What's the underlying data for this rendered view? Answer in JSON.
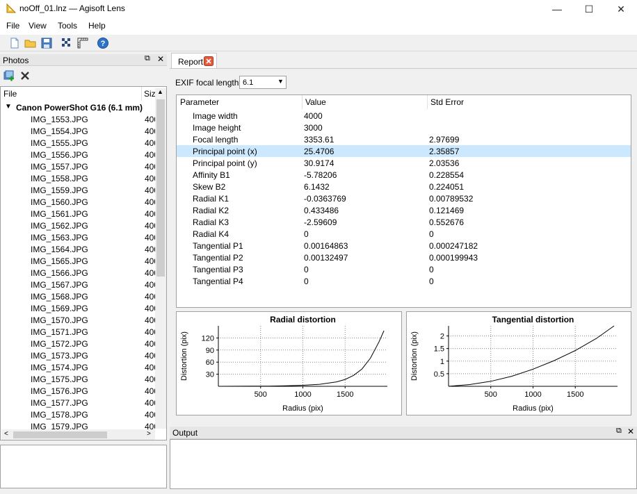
{
  "window": {
    "title": "noOff_01.lnz — Agisoft Lens",
    "minimize": "—",
    "maximize": "☐",
    "close": "✕"
  },
  "menu": [
    "File",
    "View",
    "Tools",
    "Help"
  ],
  "toolbar_icons": [
    "new-file-icon",
    "open-folder-icon",
    "save-icon",
    "calibration-pattern-icon",
    "ruler-icon",
    "help-icon"
  ],
  "photos": {
    "title": "Photos",
    "columns": [
      "File",
      "Siz"
    ],
    "group": "Canon PowerShot G16 (6.1 mm)",
    "size_prefix": "400",
    "files": [
      "IMG_1553.JPG",
      "IMG_1554.JPG",
      "IMG_1555.JPG",
      "IMG_1556.JPG",
      "IMG_1557.JPG",
      "IMG_1558.JPG",
      "IMG_1559.JPG",
      "IMG_1560.JPG",
      "IMG_1561.JPG",
      "IMG_1562.JPG",
      "IMG_1563.JPG",
      "IMG_1564.JPG",
      "IMG_1565.JPG",
      "IMG_1566.JPG",
      "IMG_1567.JPG",
      "IMG_1568.JPG",
      "IMG_1569.JPG",
      "IMG_1570.JPG",
      "IMG_1571.JPG",
      "IMG_1572.JPG",
      "IMG_1573.JPG",
      "IMG_1574.JPG",
      "IMG_1575.JPG",
      "IMG_1576.JPG",
      "IMG_1577.JPG",
      "IMG_1578.JPG",
      "IMG_1579.JPG"
    ]
  },
  "report": {
    "tab": "Report",
    "exif_label": "EXIF focal length:",
    "exif_value": "6.1",
    "columns": [
      "Parameter",
      "Value",
      "Std Error"
    ],
    "selected_row": 3,
    "rows": [
      [
        "Image width",
        "4000",
        ""
      ],
      [
        "Image height",
        "3000",
        ""
      ],
      [
        "Focal length",
        "3353.61",
        "2.97699"
      ],
      [
        "Principal point (x)",
        "25.4706",
        "2.35857"
      ],
      [
        "Principal point (y)",
        "30.9174",
        "2.03536"
      ],
      [
        "Affinity B1",
        "-5.78206",
        "0.228554"
      ],
      [
        "Skew B2",
        "6.1432",
        "0.224051"
      ],
      [
        "Radial K1",
        "-0.0363769",
        "0.00789532"
      ],
      [
        "Radial K2",
        "0.433486",
        "0.121469"
      ],
      [
        "Radial K3",
        "-2.59609",
        "0.552676"
      ],
      [
        "Radial K4",
        "0",
        "0"
      ],
      [
        "Tangential P1",
        "0.00164863",
        "0.000247182"
      ],
      [
        "Tangential P2",
        "0.00132497",
        "0.000199943"
      ],
      [
        "Tangential P3",
        "0",
        "0"
      ],
      [
        "Tangential P4",
        "0",
        "0"
      ]
    ]
  },
  "output": {
    "title": "Output"
  },
  "chart_data": [
    {
      "type": "line",
      "title": "Radial distortion",
      "xlabel": "Radius (pix)",
      "ylabel": "Distortion (pix)",
      "xlim": [
        0,
        2000
      ],
      "ylim": [
        0,
        150
      ],
      "xticks": [
        500,
        1000,
        1500
      ],
      "yticks": [
        30,
        60,
        90,
        120
      ],
      "grid": true,
      "x": [
        0,
        200,
        400,
        600,
        800,
        1000,
        1200,
        1400,
        1500,
        1600,
        1700,
        1800,
        1900,
        1960
      ],
      "y": [
        0,
        0.1,
        0.3,
        0.6,
        1.2,
        2.5,
        5,
        11,
        17,
        27,
        43,
        70,
        110,
        138
      ]
    },
    {
      "type": "line",
      "title": "Tangential distortion",
      "xlabel": "Radius (pix)",
      "ylabel": "Distortion (pix)",
      "xlim": [
        0,
        2000
      ],
      "ylim": [
        0,
        2.4
      ],
      "xticks": [
        500,
        1000,
        1500
      ],
      "yticks": [
        0.5,
        1,
        1.5,
        2
      ],
      "ytick_labels": [
        "0.5",
        "1",
        "1.5",
        "2"
      ],
      "grid": true,
      "x": [
        0,
        250,
        500,
        750,
        1000,
        1250,
        1500,
        1750,
        1960
      ],
      "y": [
        0,
        0.07,
        0.2,
        0.4,
        0.68,
        1.02,
        1.42,
        1.9,
        2.4
      ]
    }
  ]
}
